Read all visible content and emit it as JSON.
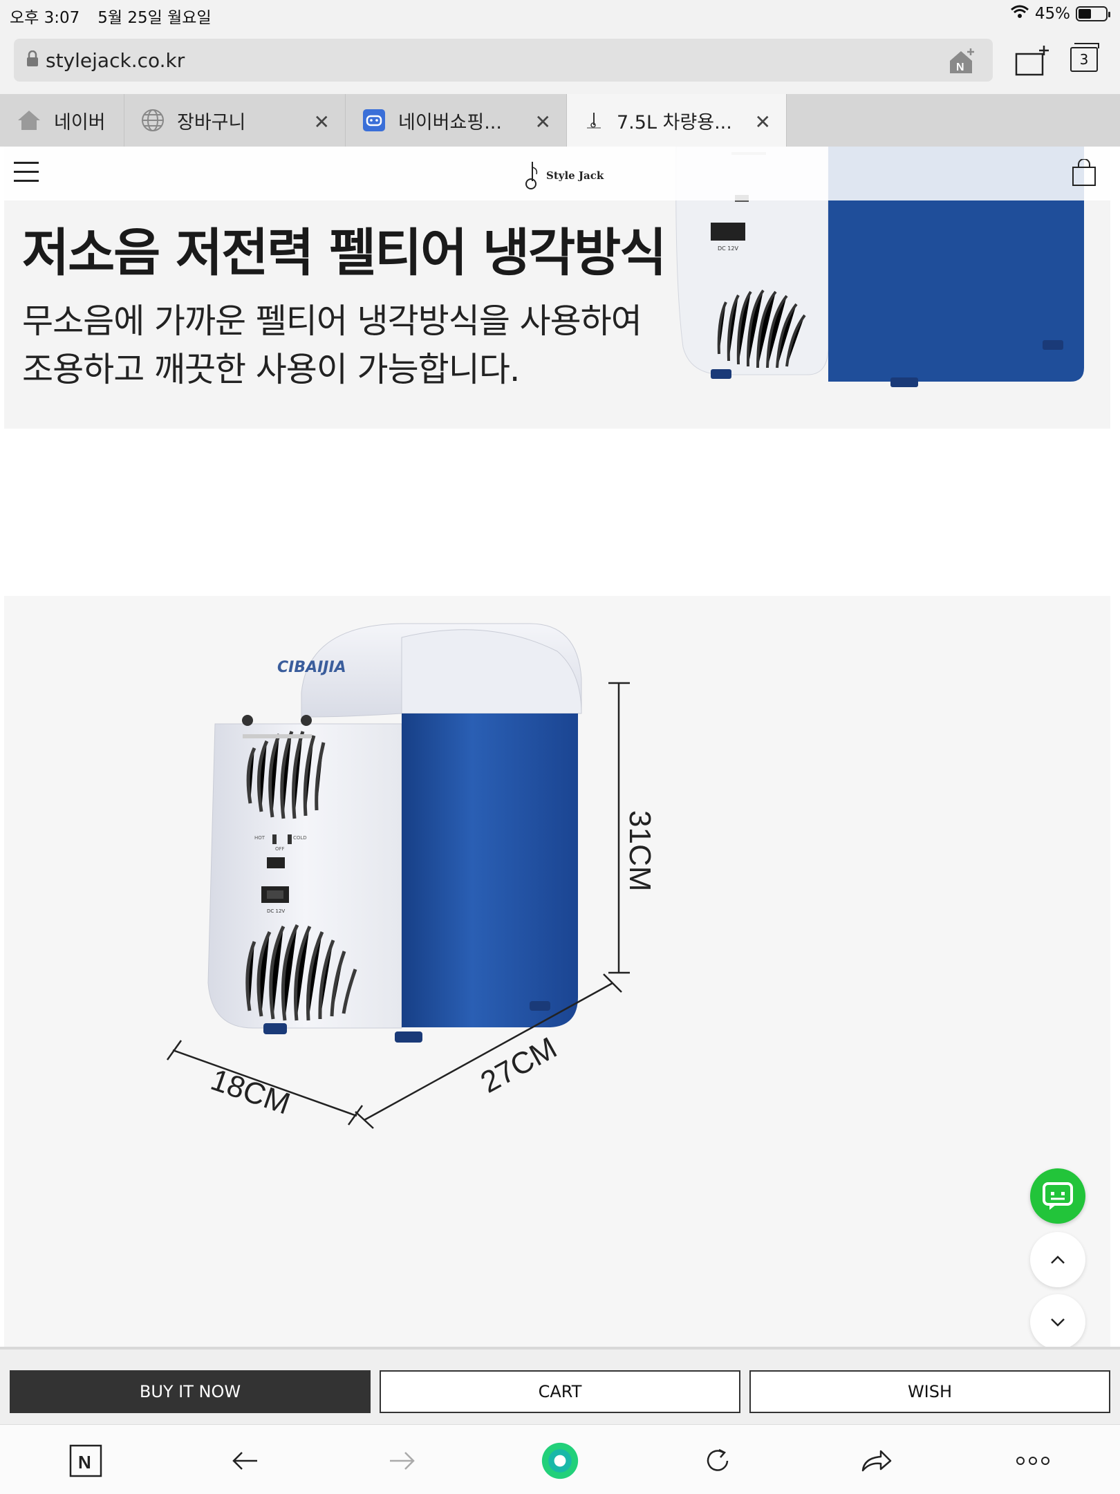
{
  "status": {
    "time": "오후 3:07",
    "date": "5월 25일 월요일",
    "battery": "45%"
  },
  "browser": {
    "url": "stylejack.co.kr",
    "tab_count": "3",
    "tabs": [
      {
        "label": "네이버",
        "active": false
      },
      {
        "label": "장바구니",
        "active": false
      },
      {
        "label": "네이버쇼핑...",
        "active": false
      },
      {
        "label": "7.5L 차량용...",
        "active": true
      }
    ]
  },
  "site": {
    "logo": "Style Jack"
  },
  "banner": {
    "headline": "저소음 저전력 펠티어 냉각방식",
    "line1": "무소음에 가까운 펠티어 냉각방식을 사용하여",
    "line2": "조용하고 깨끗한 사용이 가능합니다."
  },
  "product_photo": {
    "brand": "CIBAIJIA",
    "height_label": "31CM",
    "depth_label": "27CM",
    "width_label": "18CM",
    "switch_left": "HOT",
    "switch_right": "COLD",
    "switch_mid": "OFF",
    "power_label": "DC 12V"
  },
  "actions": {
    "buy": "BUY IT NOW",
    "cart": "CART",
    "wish": "WISH"
  },
  "colors": {
    "accent_green": "#22c43a",
    "fridge_blue": "#1f4e9a",
    "buy_bg": "#333333"
  }
}
